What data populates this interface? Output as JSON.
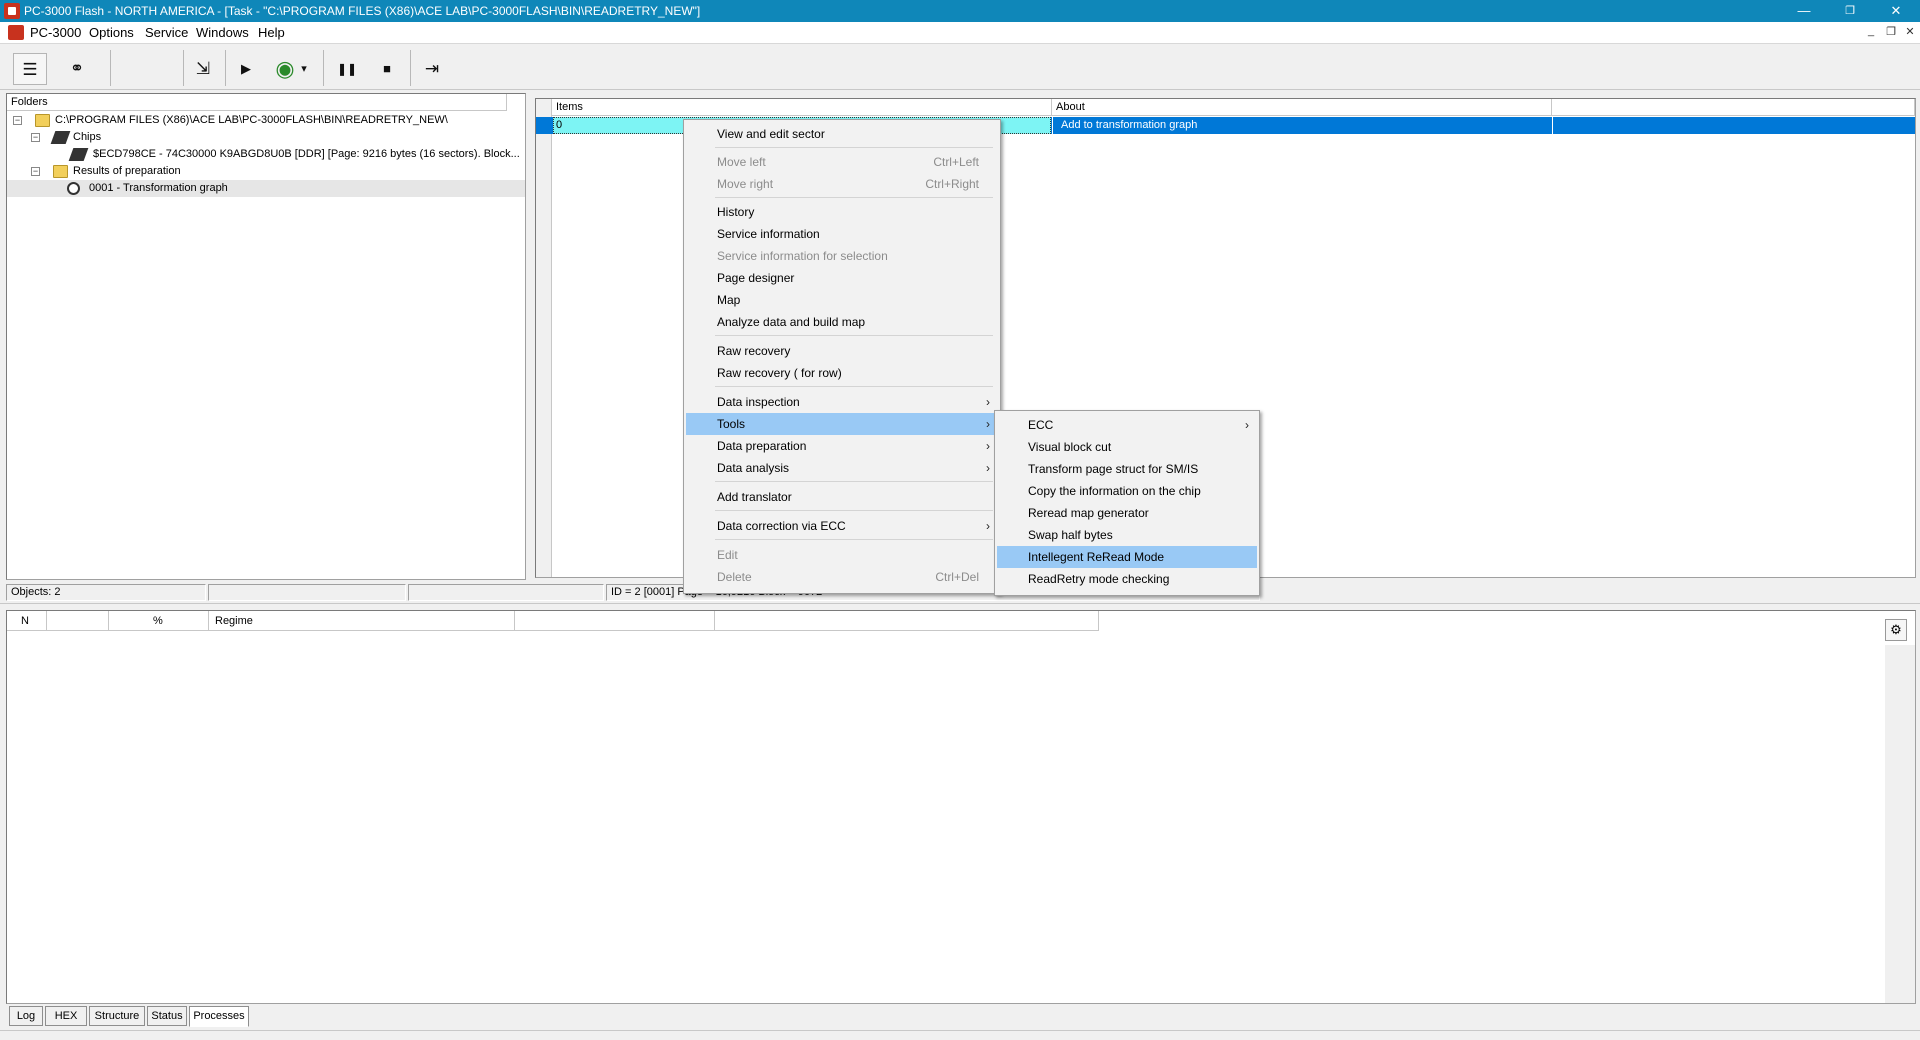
{
  "window": {
    "title": "PC-3000 Flash - NORTH AMERICA - [Task - \"C:\\PROGRAM FILES (X86)\\ACE LAB\\PC-3000FLASH\\BIN\\READRETRY_NEW\"]",
    "minimize": "—",
    "restore": "❐",
    "close": "✕"
  },
  "menubar": {
    "items": [
      "PC-3000",
      "Options",
      "Service",
      "Windows",
      "Help"
    ],
    "mdi_minimize": "_",
    "mdi_restore": "❐",
    "mdi_close": "✕"
  },
  "toolbar": {
    "icons": [
      "task-icon",
      "binoculars-icon",
      "export-icon",
      "play-icon",
      "globe-computer-icon",
      "pause-icon",
      "stop-icon",
      "exit-icon"
    ],
    "glyphs": {
      "task": "☰",
      "binoculars": "⚭",
      "export": "⇲",
      "play": "▶",
      "globe": "◉",
      "dropdown": "▾",
      "pause": "❚❚",
      "stop": "■",
      "exit": "⇥"
    }
  },
  "folders_panel": {
    "header": "Folders",
    "tree": [
      {
        "level": 0,
        "expander": "−",
        "icon": "folder-open-icon",
        "label": "C:\\PROGRAM FILES (X86)\\ACE LAB\\PC-3000FLASH\\BIN\\READRETRY_NEW\\"
      },
      {
        "level": 1,
        "expander": "−",
        "icon": "chips-icon",
        "label": "Chips"
      },
      {
        "level": 2,
        "expander": "",
        "icon": "chip-icon",
        "label": "$ECD798CE -  74C30000 K9ABGD8U0B [DDR] [Page: 9216 bytes (16 sectors). Block..."
      },
      {
        "level": 1,
        "expander": "−",
        "icon": "folder-icon",
        "label": "Results of preparation"
      },
      {
        "level": 2,
        "expander": "",
        "icon": "graph-icon",
        "label": "0001 - Transformation graph"
      }
    ]
  },
  "items_panel": {
    "columns": [
      "Items",
      "About"
    ],
    "rows": [
      {
        "item": "0",
        "about": "Add to transformation graph"
      }
    ]
  },
  "status_bar": {
    "objects": "Objects: 2",
    "cell2": "",
    "cell3": "",
    "info": "ID = 2 [0001] Page = 16,9216 Block = 9072"
  },
  "processes_panel": {
    "columns": [
      "N",
      "",
      "%",
      "Regime",
      "",
      ""
    ]
  },
  "context_menu": {
    "items": [
      {
        "label": "View and edit sector",
        "shortcut": "",
        "disabled": false,
        "submenu": false
      },
      {
        "sep": true
      },
      {
        "label": "Move left",
        "shortcut": "Ctrl+Left",
        "disabled": true,
        "submenu": false
      },
      {
        "label": "Move right",
        "shortcut": "Ctrl+Right",
        "disabled": true,
        "submenu": false
      },
      {
        "sep": true
      },
      {
        "label": "History",
        "shortcut": "",
        "disabled": false,
        "submenu": false
      },
      {
        "label": "Service information",
        "shortcut": "",
        "disabled": false,
        "submenu": false
      },
      {
        "label": "Service information for selection",
        "shortcut": "",
        "disabled": true,
        "submenu": false
      },
      {
        "label": "Page designer",
        "shortcut": "",
        "disabled": false,
        "submenu": false
      },
      {
        "label": "Map",
        "shortcut": "",
        "disabled": false,
        "submenu": false
      },
      {
        "label": "Analyze data and build map",
        "shortcut": "",
        "disabled": false,
        "submenu": false
      },
      {
        "sep": true
      },
      {
        "label": "Raw recovery",
        "shortcut": "",
        "disabled": false,
        "submenu": false
      },
      {
        "label": "Raw recovery ( for row)",
        "shortcut": "",
        "disabled": false,
        "submenu": false
      },
      {
        "sep": true
      },
      {
        "label": "Data inspection",
        "shortcut": "",
        "disabled": false,
        "submenu": true
      },
      {
        "label": "Tools",
        "shortcut": "",
        "disabled": false,
        "submenu": true,
        "highlighted": true
      },
      {
        "label": "Data preparation",
        "shortcut": "",
        "disabled": false,
        "submenu": true
      },
      {
        "label": "Data analysis",
        "shortcut": "",
        "disabled": false,
        "submenu": true
      },
      {
        "sep": true
      },
      {
        "label": "Add translator",
        "shortcut": "",
        "disabled": false,
        "submenu": false
      },
      {
        "sep": true
      },
      {
        "label": "Data correction via ECC",
        "shortcut": "",
        "disabled": false,
        "submenu": true
      },
      {
        "sep": true
      },
      {
        "label": "Edit",
        "shortcut": "",
        "disabled": true,
        "submenu": false
      },
      {
        "label": "Delete",
        "shortcut": "Ctrl+Del",
        "disabled": true,
        "submenu": false
      }
    ]
  },
  "tools_submenu": {
    "items": [
      {
        "label": "ECC",
        "submenu": true
      },
      {
        "label": "Visual block cut",
        "submenu": false
      },
      {
        "label": "Transform page struct for SM/IS",
        "submenu": false
      },
      {
        "label": "Copy the information on the chip",
        "submenu": false
      },
      {
        "label": "Reread map generator",
        "submenu": false
      },
      {
        "label": "Swap half bytes",
        "submenu": false
      },
      {
        "label": "Intellegent ReRead Mode",
        "submenu": false,
        "highlighted": true
      },
      {
        "label": "ReadRetry mode checking",
        "submenu": false
      }
    ]
  },
  "bottom_tabs": [
    "Log",
    "HEX",
    "Structure",
    "Status",
    "Processes"
  ],
  "colors": {
    "titlebar": "#0f87b9",
    "selection": "#0078d7",
    "selection_cell": "#7df4f4",
    "menu_highlight": "#99c9f5"
  },
  "arrow_glyph": "›"
}
